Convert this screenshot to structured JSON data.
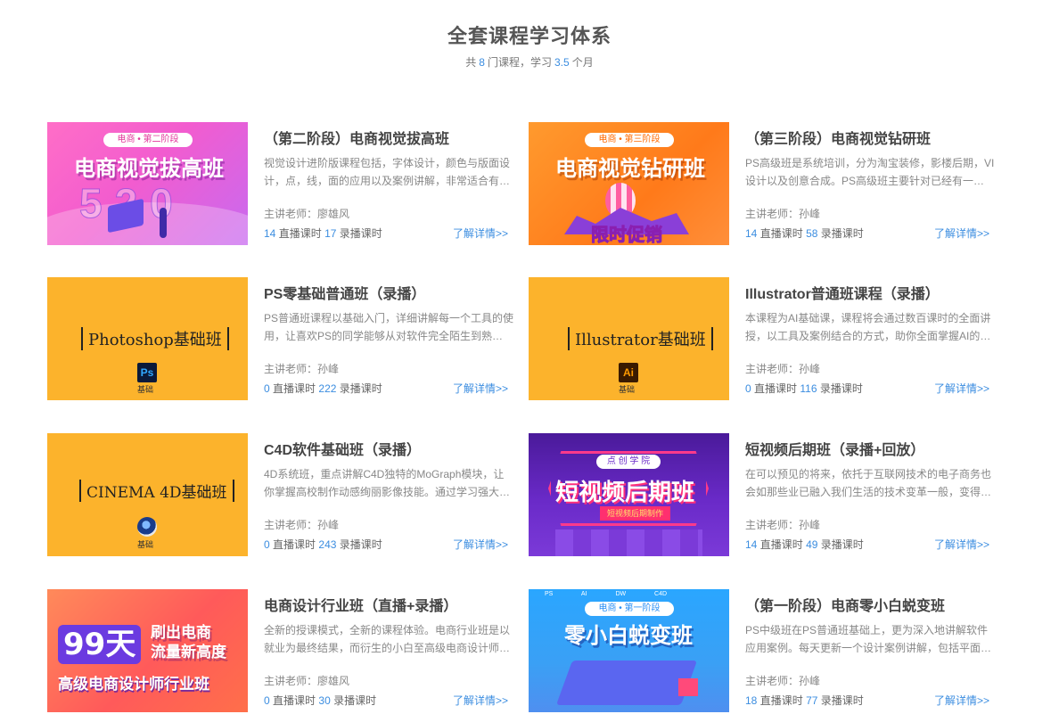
{
  "header": {
    "title": "全套课程学习体系",
    "subtitle_prefix": "共",
    "course_count": "8",
    "subtitle_mid": "门课程，学习",
    "study_months": "3.5",
    "subtitle_suffix": "个月"
  },
  "labels": {
    "teacher_prefix": "主讲老师：",
    "live_label": "直播课时",
    "recorded_label": "录播课时",
    "more_link": "了解详情>>"
  },
  "colors": {
    "accent": "#3b8de0",
    "yellow_thumb": "#fcb32c"
  },
  "courses": [
    {
      "title": "（第二阶段）电商视觉拔高班",
      "desc": "视觉设计进阶版课程包括，字体设计，颜色与版面设计，点，线，面的应用以及案例讲解，非常适合有一定基础的同学学习。",
      "teacher": "廖雄风",
      "live": "14",
      "recorded": "17",
      "thumb": {
        "pill": "电商 • 第二阶段",
        "banner": "电商视觉拔高班",
        "big": "520"
      }
    },
    {
      "title": "（第三阶段）电商视觉钻研班",
      "desc": "PS高级班是系统培训，分为淘宝装修，影楼后期，VI设计以及创意合成。PS高级班主要针对已经有一定基础的同学。",
      "teacher": "孙峰",
      "live": "14",
      "recorded": "58",
      "thumb": {
        "pill": "电商 • 第三阶段",
        "banner": "电商视觉钻研班",
        "promo": "限时促销"
      }
    },
    {
      "title": "PS零基础普通班（录播）",
      "desc": "PS普通班课程以基础入门，详细讲解每一个工具的使用，让喜欢PS的同学能够从对软件完全陌生到熟练掌握。",
      "teacher": "孙峰",
      "live": "0",
      "recorded": "222",
      "thumb": {
        "serif": "Photoshop基础班",
        "icon": "Ps",
        "sub": "基础"
      }
    },
    {
      "title": "Illustrator普通班课程（录播）",
      "desc": "本课程为AI基础课，课程将会通过数百课时的全面讲授，以工具及案例结合的方式，助你全面掌握AI的使用技巧。",
      "teacher": "孙峰",
      "live": "0",
      "recorded": "116",
      "thumb": {
        "serif": "Illustrator基础班",
        "icon": "Ai",
        "sub": "基础"
      }
    },
    {
      "title": "C4D软件基础班（录播）",
      "desc": "4D系统班，重点讲解C4D独特的MoGraph模块，让你掌握高校制作动感绚丽影像技能。通过学习强大的功能。",
      "teacher": "孙峰",
      "live": "0",
      "recorded": "243",
      "thumb": {
        "serif": "CINEMA 4D基础班",
        "sub": "基础"
      }
    },
    {
      "title": "短视频后期班（录播+回放）",
      "desc": "在可以预见的将来，依托于互联网技术的电子商务也会如那些业已融入我们生活的技术变革一般，变得无处不在。",
      "teacher": "孙峰",
      "live": "14",
      "recorded": "49",
      "thumb": {
        "pill": "点 创 学 院",
        "banner": "短视频后期班",
        "ribbon": "短视频后期制作"
      }
    },
    {
      "title": "电商设计行业班（直播+录播）",
      "desc": "全新的授课模式，全新的课程体验。电商行业班是以就业为最终结果，而衍生的小白至高级电商设计师的课程。",
      "teacher": "廖雄风",
      "live": "0",
      "recorded": "30",
      "thumb": {
        "big": "99天",
        "line1": "刷出电商",
        "line2": "流量新高度",
        "line3": "高级电商设计师行业班"
      }
    },
    {
      "title": "（第一阶段）电商零小白蜕变班",
      "desc": "PS中级班在PS普通班基础上，更为深入地讲解软件应用案例。每天更新一个设计案例讲解，包括平面设计。",
      "teacher": "孙峰",
      "live": "18",
      "recorded": "77",
      "thumb": {
        "tags": "PS AI DW C4D",
        "pill": "电商 • 第一阶段",
        "banner": "零小白蜕变班"
      }
    }
  ]
}
